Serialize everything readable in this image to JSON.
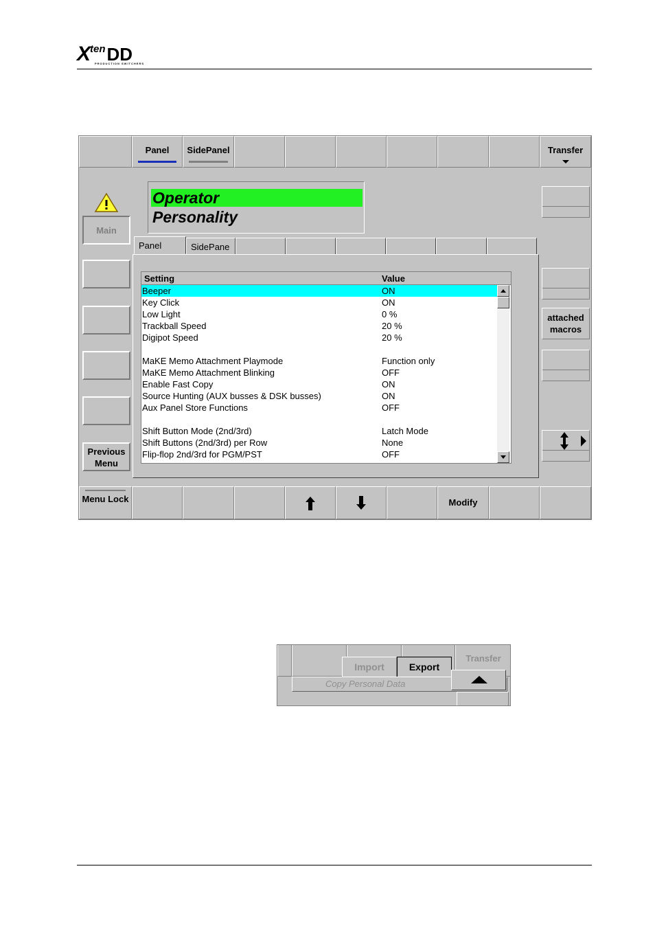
{
  "header": {
    "logo_x": "X",
    "logo_ten": "ten",
    "logo_dd": "DD",
    "logo_sub": "PRODUCTION SWITCHERS"
  },
  "main_screen": {
    "top_bar": {
      "panel_label": "Panel",
      "sidepanel_label": "SidePanel",
      "transfer_label": "Transfer"
    },
    "left_buttons": {
      "main_label": "Main",
      "previous_menu_label": "Previous Menu"
    },
    "title": {
      "line1": "Operator",
      "line2": "Personality"
    },
    "tabs": [
      {
        "label": "Panel"
      },
      {
        "label": "SidePane"
      }
    ],
    "table": {
      "headers": {
        "setting": "Setting",
        "value": "Value"
      },
      "rows": [
        {
          "setting": "Beeper",
          "value": "ON",
          "selected": true
        },
        {
          "setting": "Key Click",
          "value": "ON"
        },
        {
          "setting": "Low Light",
          "value": "0 %"
        },
        {
          "setting": "Trackball Speed",
          "value": "20 %"
        },
        {
          "setting": "Digipot Speed",
          "value": "20 %"
        },
        {
          "setting": "",
          "value": ""
        },
        {
          "setting": "MaKE Memo Attachment Playmode",
          "value": "Function only"
        },
        {
          "setting": "MaKE Memo Attachment Blinking",
          "value": "OFF"
        },
        {
          "setting": "Enable Fast Copy",
          "value": "ON"
        },
        {
          "setting": "Source Hunting (AUX busses & DSK busses)",
          "value": "ON"
        },
        {
          "setting": "Aux Panel Store Functions",
          "value": "OFF"
        },
        {
          "setting": "",
          "value": ""
        },
        {
          "setting": "Shift Button Mode (2nd/3rd)",
          "value": "Latch Mode"
        },
        {
          "setting": "Shift Buttons (2nd/3rd) per Row",
          "value": "None"
        },
        {
          "setting": "Flip-flop 2nd/3rd for PGM/PST",
          "value": "OFF"
        }
      ]
    },
    "right_buttons": {
      "attached_macros_label": "attached macros"
    },
    "bottom_bar": {
      "menu_lock_label": "Menu Lock",
      "modify_label": "Modify"
    },
    "colors": {
      "panel_bg": "#c3c3c3",
      "title_highlight": "#22f022",
      "row_selection": "#00ffff",
      "tab_underline_active": "#1a2fb8"
    }
  },
  "transfer_popup": {
    "import_label": "Import",
    "export_label": "Export",
    "transfer_label": "Transfer",
    "copy_label": "Copy Personal Data"
  }
}
